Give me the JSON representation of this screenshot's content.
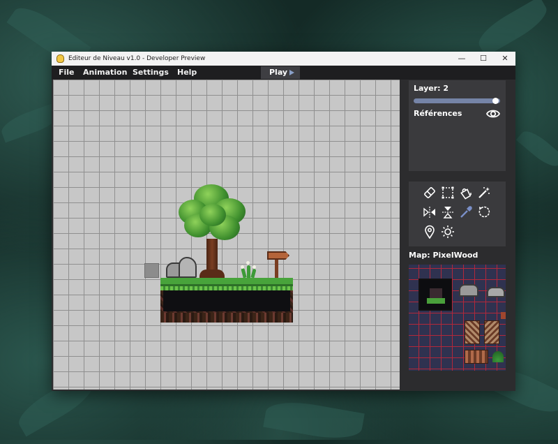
{
  "window": {
    "title": "Editeur de Niveau v1.0 - Developer Preview",
    "controls": {
      "minimize": "—",
      "maximize": "☐",
      "close": "✕"
    }
  },
  "menu": {
    "items": [
      "File",
      "Animation",
      "Settings",
      "Help"
    ],
    "play_label": "Play"
  },
  "sidebar": {
    "layer_label": "Layer: 2",
    "layer_slider_fraction": 1.0,
    "references_label": "Références",
    "tools": [
      "eraser-icon",
      "select-icon",
      "fill-bucket-icon",
      "magic-wand-icon",
      "flip-horizontal-icon",
      "flip-vertical-icon",
      "eyedropper-icon",
      "rotate-icon",
      "pin-icon",
      "light-icon"
    ],
    "map_label": "Map: PixelWood"
  },
  "colors": {
    "canvas_background": "#c7c7c7",
    "slider_track": "#7584a7",
    "map_grid": "#b3283a",
    "map_background": "#2f3250"
  }
}
